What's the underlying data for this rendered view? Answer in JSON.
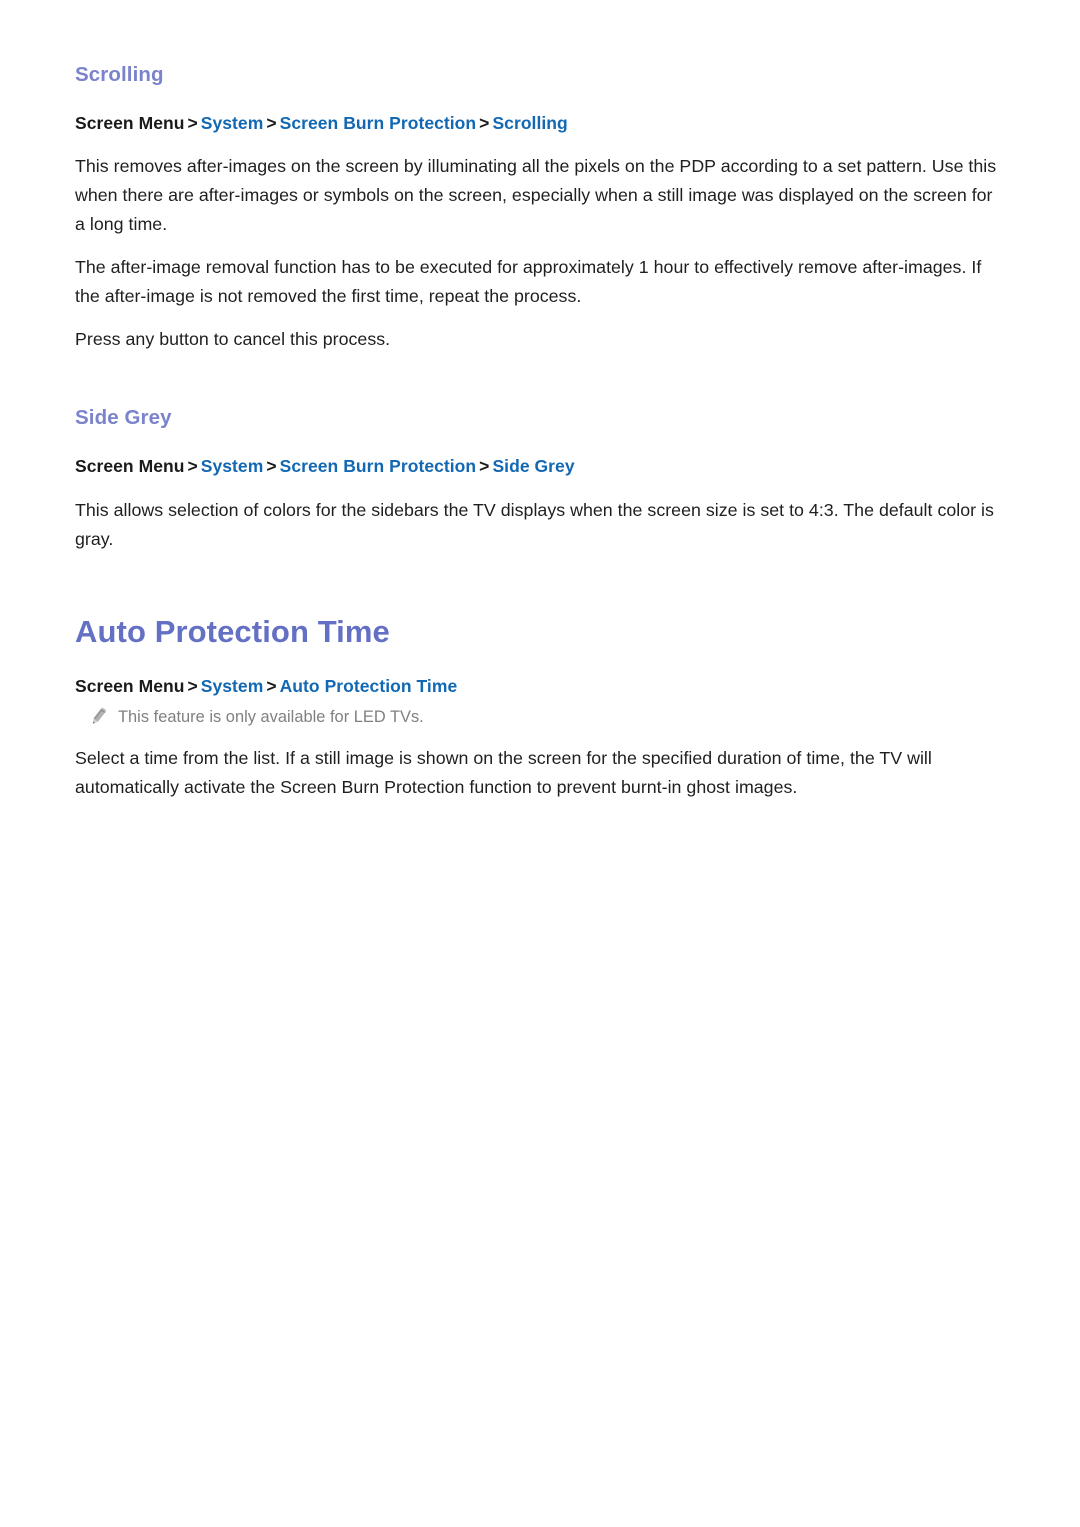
{
  "document": {
    "sections": [
      {
        "id": "scrolling",
        "heading": "Scrolling",
        "heading_level": "h2",
        "breadcrumb": {
          "root": "Screen Menu",
          "separator": ">",
          "links": [
            "System",
            "Screen Burn Protection",
            "Scrolling"
          ]
        },
        "paragraphs": [
          "This removes after-images on the screen by illuminating all the pixels on the PDP according to a set pattern. Use this when there are after-images or symbols on the screen, especially when a still image was displayed on the screen for a long time.",
          "The after-image removal function has to be executed for approximately 1 hour to effectively remove after-images. If the after-image is not removed the first time, repeat the process.",
          "Press any button to cancel this process."
        ]
      },
      {
        "id": "side-grey",
        "heading": "Side Grey",
        "heading_level": "h2",
        "breadcrumb": {
          "root": "Screen Menu",
          "separator": ">",
          "links": [
            "System",
            "Screen Burn Protection",
            "Side Grey"
          ]
        },
        "paragraphs": [
          "This allows selection of colors for the sidebars the TV displays when the screen size is set to 4:3. The default color is gray."
        ]
      },
      {
        "id": "auto-protection-time",
        "heading": "Auto Protection Time",
        "heading_level": "h1",
        "breadcrumb": {
          "root": "Screen Menu",
          "separator": ">",
          "links": [
            "System",
            "Auto Protection Time"
          ]
        },
        "note": {
          "icon": "pencil-icon",
          "text": "This feature is only available for LED TVs."
        },
        "paragraphs": [
          "Select a time from the list. If a still image is shown on the screen for the specified duration of time, the TV will automatically activate the Screen Burn Protection function to prevent burnt-in ghost images."
        ]
      }
    ]
  },
  "colors": {
    "doc_title": "#6370c4",
    "section_title": "#7b83cc",
    "breadcrumb_link": "#1268b3",
    "breadcrumb_root": "#1a1a1a",
    "body_text": "#1f1f1f",
    "note_text": "#808080",
    "page_background": "#ffffff"
  }
}
